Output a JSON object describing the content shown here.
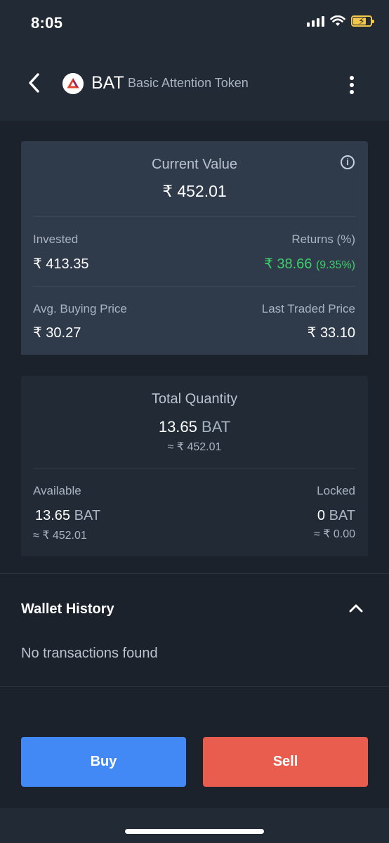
{
  "status_bar": {
    "time": "8:05"
  },
  "header": {
    "symbol": "BAT",
    "name": "Basic Attention Token",
    "icons": {
      "back": "chevron-left-icon",
      "more": "more-vertical-icon",
      "coin": "bat-logo-icon"
    }
  },
  "current_value_card": {
    "label": "Current Value",
    "value": "₹ 452.01",
    "invested_label": "Invested",
    "invested_value": "₹ 413.35",
    "returns_label": "Returns (%)",
    "returns_value": "₹ 38.66",
    "returns_percent": "(9.35%)",
    "avg_buying_label": "Avg. Buying Price",
    "avg_buying_value": "₹ 30.27",
    "last_traded_label": "Last Traded Price",
    "last_traded_value": "₹ 33.10"
  },
  "quantity_card": {
    "label": "Total Quantity",
    "quantity": "13.65",
    "unit": "BAT",
    "approx_value": "≈ ₹ 452.01",
    "available_label": "Available",
    "available_quantity": "13.65",
    "available_unit": "BAT",
    "available_approx": "≈ ₹ 452.01",
    "locked_label": "Locked",
    "locked_quantity": "0",
    "locked_unit": "BAT",
    "locked_approx": "≈ ₹ 0.00"
  },
  "wallet_history": {
    "title": "Wallet History",
    "empty_message": "No transactions found"
  },
  "actions": {
    "buy_label": "Buy",
    "sell_label": "Sell"
  },
  "colors": {
    "background": "#1b222c",
    "card": "#2f3a4b",
    "positive": "#3ecf6a",
    "buy": "#4289f5",
    "sell": "#e85d4e"
  }
}
